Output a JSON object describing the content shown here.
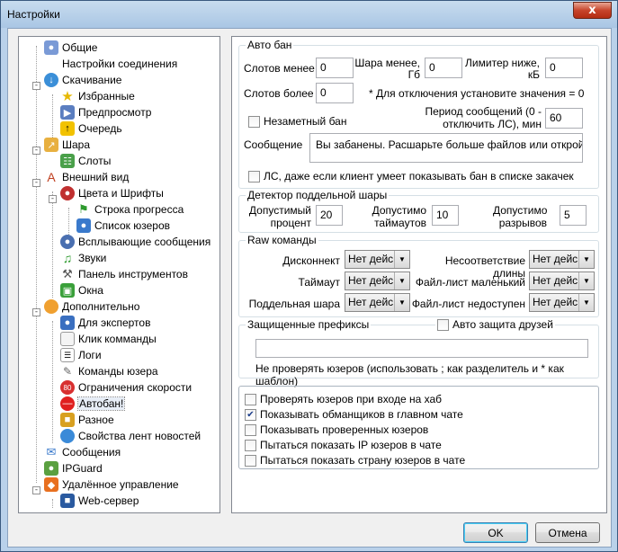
{
  "window": {
    "title": "Настройки",
    "close_glyph": "x"
  },
  "tree": {
    "items": [
      {
        "label": "Общие",
        "icon": "users-icon"
      },
      {
        "label": "Настройки соединения",
        "icon": "network-icon"
      },
      {
        "label": "Скачивание",
        "icon": "download-icon"
      },
      {
        "label": "Избранные",
        "icon": "star-icon"
      },
      {
        "label": "Предпросмотр",
        "icon": "preview-icon"
      },
      {
        "label": "Очередь",
        "icon": "queue-icon"
      },
      {
        "label": "Шара",
        "icon": "share-icon"
      },
      {
        "label": "Слоты",
        "icon": "slots-icon"
      },
      {
        "label": "Внешний вид",
        "icon": "appearance-icon"
      },
      {
        "label": "Цвета и Шрифты",
        "icon": "palette-icon"
      },
      {
        "label": "Строка прогресса",
        "icon": "progress-flag-icon"
      },
      {
        "label": "Список юзеров",
        "icon": "user-list-icon"
      },
      {
        "label": "Всплывающие сообщения",
        "icon": "popup-icon"
      },
      {
        "label": "Звуки",
        "icon": "sound-icon"
      },
      {
        "label": "Панель инструментов",
        "icon": "tools-icon"
      },
      {
        "label": "Окна",
        "icon": "windows-icon"
      },
      {
        "label": "Дополнительно",
        "icon": "advanced-icon"
      },
      {
        "label": "Для экспертов",
        "icon": "expert-icon"
      },
      {
        "label": "Клик комманды",
        "icon": "click-command-icon"
      },
      {
        "label": "Логи",
        "icon": "logs-icon"
      },
      {
        "label": "Команды юзера",
        "icon": "user-commands-icon"
      },
      {
        "label": "Ограничения скорости",
        "icon": "speed-limit-icon"
      },
      {
        "label": "Автобан!",
        "icon": "no-entry-icon"
      },
      {
        "label": "Разное",
        "icon": "lock-icon"
      },
      {
        "label": "Свойства лент новостей",
        "icon": "globe-icon"
      },
      {
        "label": "Сообщения",
        "icon": "messages-icon"
      },
      {
        "label": "IPGuard",
        "icon": "ipguard-icon"
      },
      {
        "label": "Удалённое управление",
        "icon": "remote-icon"
      },
      {
        "label": "Web-сервер",
        "icon": "webserver-icon"
      }
    ]
  },
  "autoban": {
    "title": "Авто бан",
    "slots_less_label": "Слотов менее",
    "slots_less_value": "0",
    "share_less_label_1": "Шара менее,",
    "share_less_label_2": "Гб",
    "share_less_value": "0",
    "limiter_label_1": "Лимитер ниже,",
    "limiter_label_2": "кБ",
    "limiter_value": "0",
    "slots_more_label": "Слотов более",
    "slots_more_value": "0",
    "disable_hint": "* Для отключения установите значения = 0",
    "stealth_ban_label": "Незаметный бан",
    "stealth_ban_checked": false,
    "period_label_1": "Период сообщений (0 -",
    "period_label_2": "отключить ЛС), мин",
    "period_value": "60",
    "message_label": "Сообщение",
    "message_value": "Вы забанены. Расшарьте больше файлов или откройте больше слотов",
    "pm_label": "ЛС, даже если клиент умеет показывать бан в списке закачек",
    "pm_checked": false
  },
  "fake_share": {
    "title": "Детектор поддельной шары",
    "percent_label_1": "Допустимый",
    "percent_label_2": "процент",
    "percent_value": "20",
    "timeouts_label_1": "Допустимо",
    "timeouts_label_2": "таймаутов",
    "timeouts_value": "10",
    "disconnects_label_1": "Допустимо",
    "disconnects_label_2": "разрывов",
    "disconnects_value": "5"
  },
  "raw": {
    "title": "Raw команды",
    "rows": [
      {
        "left_label": "Дисконнект",
        "left_value": "Нет действия",
        "right_label": "Несоответствие длины",
        "right_value": "Нет действия"
      },
      {
        "left_label": "Таймаут",
        "left_value": "Нет действия",
        "right_label": "Файл-лист маленький",
        "right_value": "Нет действия"
      },
      {
        "left_label": "Поддельная шара",
        "left_value": "Нет действия",
        "right_label": "Файл-лист недоступен",
        "right_value": "Нет действия"
      }
    ]
  },
  "prefixes": {
    "title": "Защищенные префиксы",
    "auto_protect_label": "Авто защита друзей",
    "auto_protect_checked": false,
    "value": "",
    "hint": "Не проверять юзеров (использовать ; как разделитель и * как шаблон)"
  },
  "options": [
    {
      "label": "Проверять юзеров при входе на хаб",
      "checked": false
    },
    {
      "label": "Показывать обманщиков в главном чате",
      "checked": true
    },
    {
      "label": "Показывать проверенных юзеров",
      "checked": false
    },
    {
      "label": "Пытаться показать IP юзеров в чате",
      "checked": false
    },
    {
      "label": "Пытаться показать страну юзеров в чате",
      "checked": false
    }
  ],
  "buttons": {
    "ok": "OK",
    "cancel": "Отмена"
  },
  "colors": {
    "titlebar": "#aac6e4",
    "selection": "#e8eef7",
    "close": "#c7452c"
  }
}
